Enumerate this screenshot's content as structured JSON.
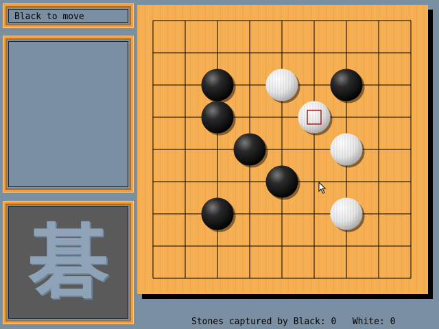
{
  "status": {
    "text": "Black to move"
  },
  "message_panel": {
    "text": ""
  },
  "logo": {
    "glyph": "碁"
  },
  "board": {
    "size": 9,
    "stones": [
      {
        "color": "black",
        "col": 2,
        "row": 2
      },
      {
        "color": "white",
        "col": 4,
        "row": 2
      },
      {
        "color": "black",
        "col": 6,
        "row": 2
      },
      {
        "color": "black",
        "col": 2,
        "row": 3
      },
      {
        "color": "white",
        "col": 5,
        "row": 3,
        "last_move": true
      },
      {
        "color": "black",
        "col": 3,
        "row": 4
      },
      {
        "color": "white",
        "col": 6,
        "row": 4
      },
      {
        "color": "black",
        "col": 4,
        "row": 5
      },
      {
        "color": "black",
        "col": 2,
        "row": 6
      },
      {
        "color": "white",
        "col": 6,
        "row": 6
      }
    ]
  },
  "footer": {
    "captured_by_black_label": "Stones captured by Black:",
    "captured_by_black": "0",
    "captured_by_white_label": "White:",
    "captured_by_white": "0"
  },
  "colors": {
    "board": "#f5ae52",
    "frame": "#f0a040",
    "background": "#7b8fa3",
    "last_move_marker": "#b01818"
  }
}
